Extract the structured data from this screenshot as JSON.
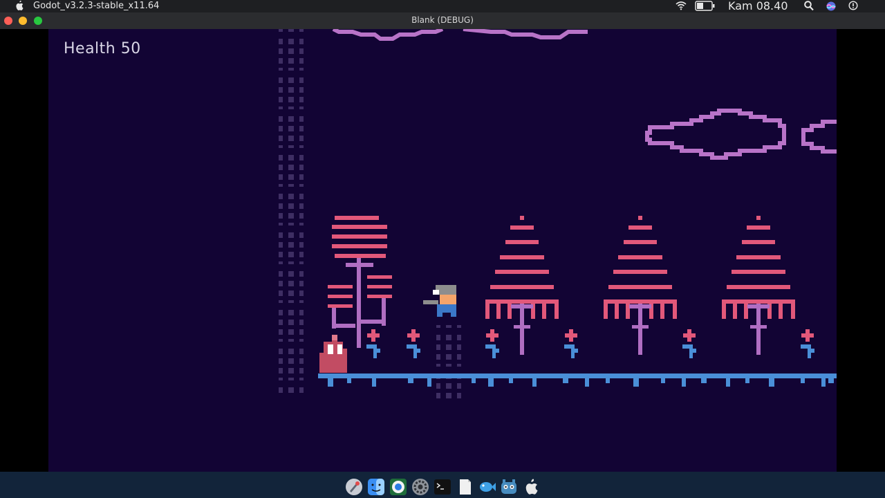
{
  "menubar": {
    "app_name": "Godot_v3.2.3-stable_x11.64",
    "clock": "Kam 08.40",
    "icons": [
      "apple-icon",
      "wifi-icon",
      "battery-icon",
      "search-icon",
      "siri-icon",
      "info-icon"
    ]
  },
  "window": {
    "title": "Blank (DEBUG)",
    "controls": [
      "close",
      "minimize",
      "maximize"
    ]
  },
  "game": {
    "hud": {
      "health_text": "Health 50"
    },
    "colors": {
      "background": "#120434",
      "ground": "#4a8fd8",
      "tree": "#e2587a",
      "trunk": "#b06ec2",
      "cloud": "#b873c8",
      "flower_petal": "#e2587a",
      "flower_leaf": "#4a8fd8",
      "ladder": "#3e2e63",
      "slime": "#c24c63",
      "player_skin": "#f4a46a",
      "player_shirt": "#3b78c8",
      "player_helmet": "#8d8d8d"
    }
  },
  "dock": {
    "items": [
      "launchpad-icon",
      "finder-icon",
      "chrome-icon",
      "system-preferences-icon",
      "terminal-icon",
      "files-icon",
      "fish-icon",
      "godot-icon",
      "apple-icon"
    ]
  }
}
